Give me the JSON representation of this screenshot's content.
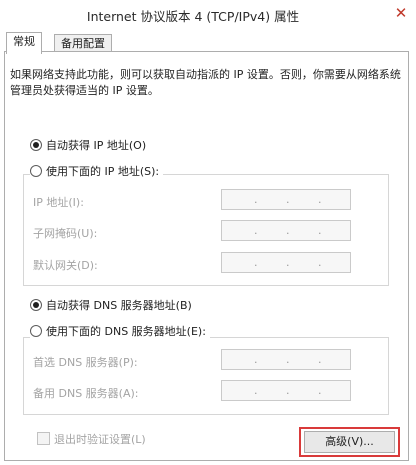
{
  "window": {
    "title": "Internet 协议版本 4 (TCP/IPv4) 属性",
    "close_glyph": "✕"
  },
  "tabs": [
    {
      "label": "常规",
      "active": true
    },
    {
      "label": "备用配置",
      "active": false
    }
  ],
  "description": "如果网络支持此功能，则可以获取自动指派的 IP 设置。否则，你需要从网络系统管理员处获得适当的 IP 设置。",
  "ip_section": {
    "auto_option": "自动获得 IP 地址(O)",
    "manual_option": "使用下面的 IP 地址(S):",
    "selected": "auto",
    "fields": [
      {
        "label": "IP 地址(I):",
        "value": ". . ."
      },
      {
        "label": "子网掩码(U):",
        "value": ". . ."
      },
      {
        "label": "默认网关(D):",
        "value": ". . ."
      }
    ]
  },
  "dns_section": {
    "auto_option": "自动获得 DNS 服务器地址(B)",
    "manual_option": "使用下面的 DNS 服务器地址(E):",
    "selected": "auto",
    "fields": [
      {
        "label": "首选 DNS 服务器(P):",
        "value": ". . ."
      },
      {
        "label": "备用 DNS 服务器(A):",
        "value": ". . ."
      }
    ]
  },
  "validate_checkbox": {
    "label": "退出时验证设置(L)",
    "checked": false,
    "enabled": false
  },
  "advanced_button": {
    "label": "高级(V)..."
  },
  "colors": {
    "highlight": "#d93a3a",
    "disabled_text": "#a4a4a4"
  }
}
